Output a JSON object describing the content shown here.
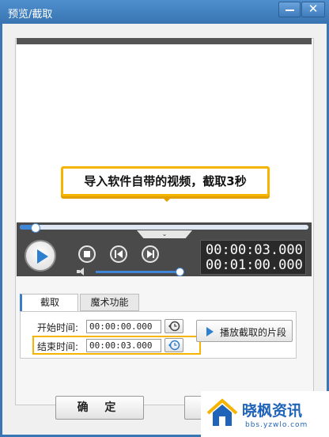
{
  "window": {
    "title": "预览/截取",
    "minimize_symbol": "",
    "close_symbol": "✕"
  },
  "preview": {
    "caption": "导入软件自带的视频，截取3秒"
  },
  "player": {
    "progress": 0.05,
    "volume": 1.0,
    "current_time": "00:00:03.000",
    "total_time": "00:01:00.000",
    "expand_symbol": "⌄"
  },
  "tabs": [
    {
      "label": "截取",
      "active": true
    },
    {
      "label": "魔术功能",
      "active": false
    }
  ],
  "capture": {
    "start_label": "开始时间:",
    "start_value": "00:00:00.000",
    "end_label": "结束时间:",
    "end_value": "00:00:03.000",
    "play_segment_label": "播放截取的片段"
  },
  "footer": {
    "ok_label": "确 定"
  },
  "watermark": {
    "name": "晓枫资讯",
    "url": "bbs.yzwlo.com"
  },
  "colors": {
    "accent": "#3f86d8",
    "highlight": "#f4b400",
    "titlebar": "#3874b1"
  }
}
